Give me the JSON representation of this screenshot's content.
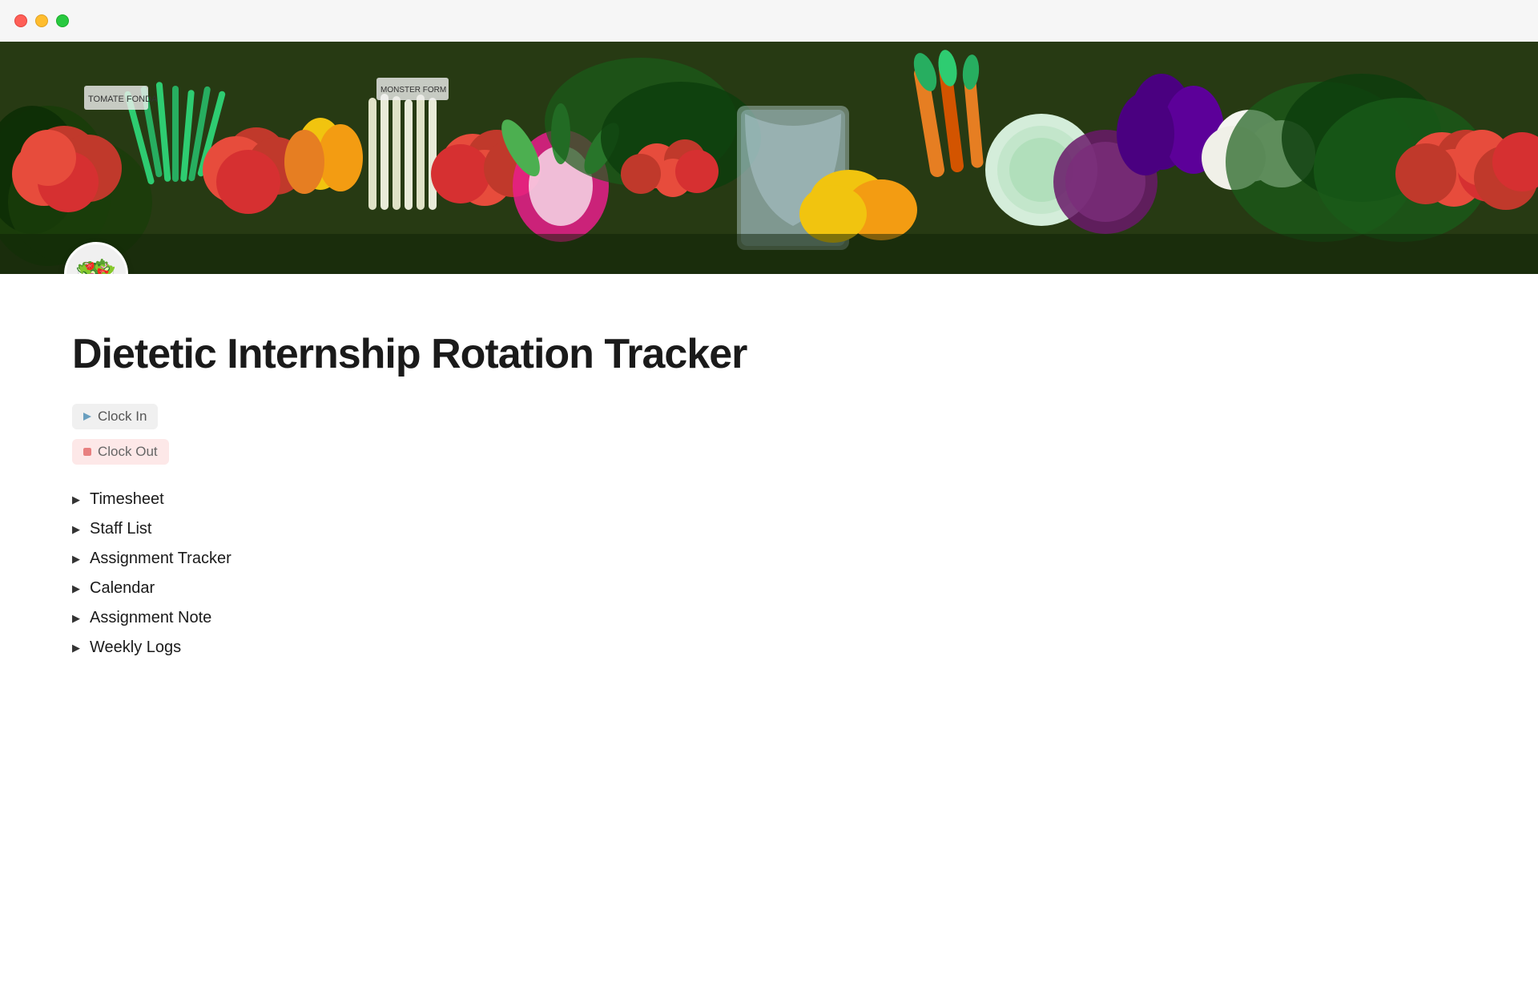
{
  "window": {
    "traffic_lights": {
      "close": "close",
      "minimize": "minimize",
      "maximize": "maximize"
    }
  },
  "page": {
    "icon": "🥗",
    "title": "Dietetic Internship Rotation Tracker",
    "buttons": [
      {
        "id": "clock-in",
        "label": "Clock In",
        "icon_type": "triangle",
        "icon_color": "#6a9fbf",
        "bg_color": "#f0f0f0"
      },
      {
        "id": "clock-out",
        "label": "Clock Out",
        "icon_type": "square",
        "icon_color": "#e88080",
        "bg_color": "#fde8e8"
      }
    ],
    "nav_items": [
      {
        "id": "timesheet",
        "label": "Timesheet"
      },
      {
        "id": "staff-list",
        "label": "Staff List"
      },
      {
        "id": "assignment-tracker",
        "label": "Assignment Tracker"
      },
      {
        "id": "calendar",
        "label": "Calendar"
      },
      {
        "id": "assignment-note",
        "label": "Assignment Note"
      },
      {
        "id": "weekly-logs",
        "label": "Weekly Logs"
      }
    ]
  }
}
